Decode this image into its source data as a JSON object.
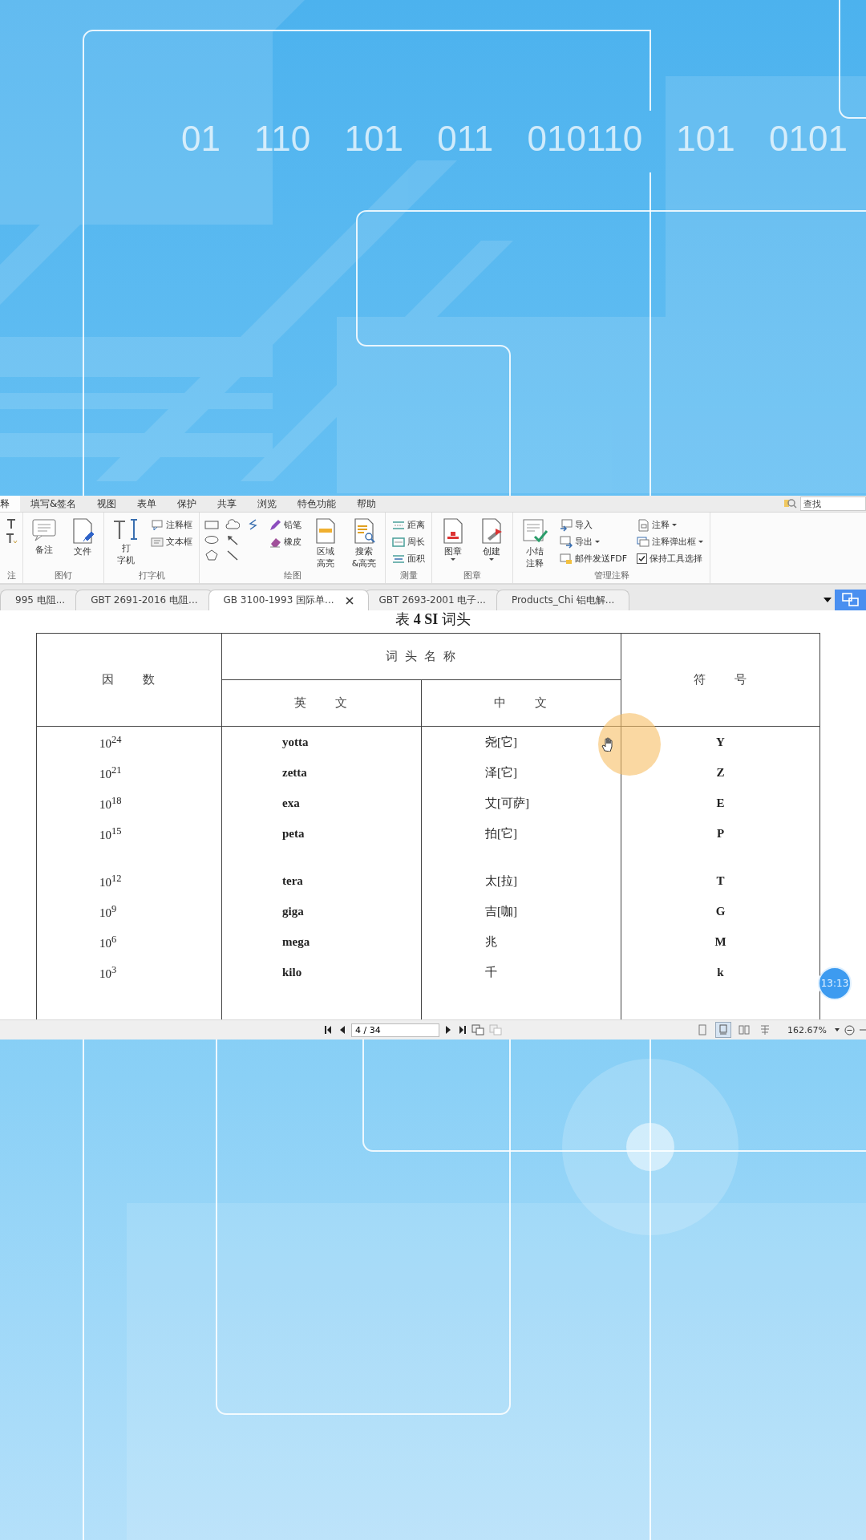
{
  "background": {
    "binary_text": "01 110 101 011 010110 101 0101"
  },
  "menu_tabs": [
    {
      "label": "释",
      "selected": true
    },
    {
      "label": "填写&签名",
      "selected": false
    },
    {
      "label": "视图",
      "selected": false
    },
    {
      "label": "表单",
      "selected": false
    },
    {
      "label": "保护",
      "selected": false
    },
    {
      "label": "共享",
      "selected": false
    },
    {
      "label": "浏览",
      "selected": false
    },
    {
      "label": "特色功能",
      "selected": false
    },
    {
      "label": "帮助",
      "selected": false
    }
  ],
  "search": {
    "placeholder": "查找"
  },
  "ribbon_groups": [
    {
      "label": "注",
      "columns": [
        {
          "kind": "stack",
          "tools": [
            {
              "kind": "icon"
            },
            {
              "kind": "icon"
            }
          ]
        }
      ]
    },
    {
      "label": "图钉",
      "columns": [
        {
          "kind": "large",
          "lines": [
            "备注"
          ],
          "dropdown": false
        },
        {
          "kind": "large",
          "lines": [
            "文件"
          ],
          "dropdown": false
        }
      ]
    },
    {
      "label": "打字机",
      "columns": [
        {
          "kind": "large",
          "lines": [
            "打",
            "字机"
          ],
          "dropdown": false
        },
        {
          "kind": "stack",
          "tools": [
            {
              "kind": "small",
              "label": "注释框",
              "dropdown": false
            },
            {
              "kind": "small",
              "label": "文本框",
              "dropdown": false
            }
          ]
        }
      ]
    },
    {
      "label": "绘图",
      "columns": [
        {
          "kind": "shapes"
        },
        {
          "kind": "stack",
          "tools": [
            {
              "kind": "small",
              "label": "铅笔",
              "dropdown": false
            },
            {
              "kind": "small",
              "label": "橡皮",
              "dropdown": false
            }
          ]
        },
        {
          "kind": "large",
          "lines": [
            "区域",
            "高亮"
          ],
          "dropdown": false
        },
        {
          "kind": "large",
          "lines": [
            "搜索",
            "&高亮"
          ],
          "dropdown": false
        }
      ]
    },
    {
      "label": "测量",
      "columns": [
        {
          "kind": "stack",
          "tools": [
            {
              "kind": "small",
              "label": "距离",
              "dropdown": false
            },
            {
              "kind": "small",
              "label": "周长",
              "dropdown": false
            },
            {
              "kind": "small",
              "label": "面积",
              "dropdown": false
            }
          ]
        }
      ]
    },
    {
      "label": "图章",
      "columns": [
        {
          "kind": "large",
          "lines": [
            "图章"
          ],
          "dropdown": true
        },
        {
          "kind": "large",
          "lines": [
            "创建"
          ],
          "dropdown": true
        }
      ]
    },
    {
      "label": "管理注释",
      "columns": [
        {
          "kind": "large",
          "lines": [
            "小结",
            "注释"
          ],
          "dropdown": false
        },
        {
          "kind": "stack",
          "tools": [
            {
              "kind": "small",
              "label": "导入",
              "dropdown": false
            },
            {
              "kind": "small",
              "label": "导出",
              "dropdown": true
            },
            {
              "kind": "small",
              "label": "邮件发送FDF",
              "dropdown": false
            }
          ]
        },
        {
          "kind": "stack",
          "tools": [
            {
              "kind": "small",
              "label": "注释",
              "dropdown": true
            },
            {
              "kind": "small",
              "label": "注释弹出框",
              "dropdown": true
            },
            {
              "kind": "checkbox",
              "label": "保持工具选择",
              "checked": true
            }
          ]
        }
      ]
    }
  ],
  "doc_tabs": [
    {
      "label": "995 电阻...",
      "selected": false
    },
    {
      "label": "GBT 2691-2016 电阻...",
      "selected": false
    },
    {
      "label": "GB 3100-1993 国际单...",
      "selected": true
    },
    {
      "label": "GBT 2693-2001 电子...",
      "selected": false
    },
    {
      "label": "Products_Chi 铝电解...",
      "selected": false
    }
  ],
  "document": {
    "title": "表 **4**  **SI** 词头",
    "headers": {
      "factor": "因　　数",
      "prefix_name": "词 头 名 称",
      "english": "英　　文",
      "chinese": "中　　文",
      "symbol": "符　　号"
    },
    "row_groups": [
      [
        {
          "factor": "10$^{24}$",
          "english": "yotta",
          "chinese": "尧[它]",
          "symbol": "Y"
        },
        {
          "factor": "10$^{21}$",
          "english": "zetta",
          "chinese": "泽[它]",
          "symbol": "Z"
        },
        {
          "factor": "10$^{18}$",
          "english": "exa",
          "chinese": "艾[可萨]",
          "symbol": "E"
        },
        {
          "factor": "10$^{15}$",
          "english": "peta",
          "chinese": "拍[它]",
          "symbol": "P"
        }
      ],
      [
        {
          "factor": "10$^{12}$",
          "english": "tera",
          "chinese": "太[拉]",
          "symbol": "T"
        },
        {
          "factor": "10$^{9}$",
          "english": "giga",
          "chinese": "吉[咖]",
          "symbol": "G"
        },
        {
          "factor": "10$^{6}$",
          "english": "mega",
          "chinese": "兆",
          "symbol": "M"
        },
        {
          "factor": "10$^{3}$",
          "english": "kilo",
          "chinese": "千",
          "symbol": "k"
        }
      ]
    ]
  },
  "timer_badge": "13:13",
  "status_bar": {
    "page_field": "4 / 34",
    "view_modes": [
      {
        "selected": false
      },
      {
        "selected": true
      },
      {
        "selected": false
      },
      {
        "selected": false
      }
    ],
    "zoom": "162.67%"
  }
}
